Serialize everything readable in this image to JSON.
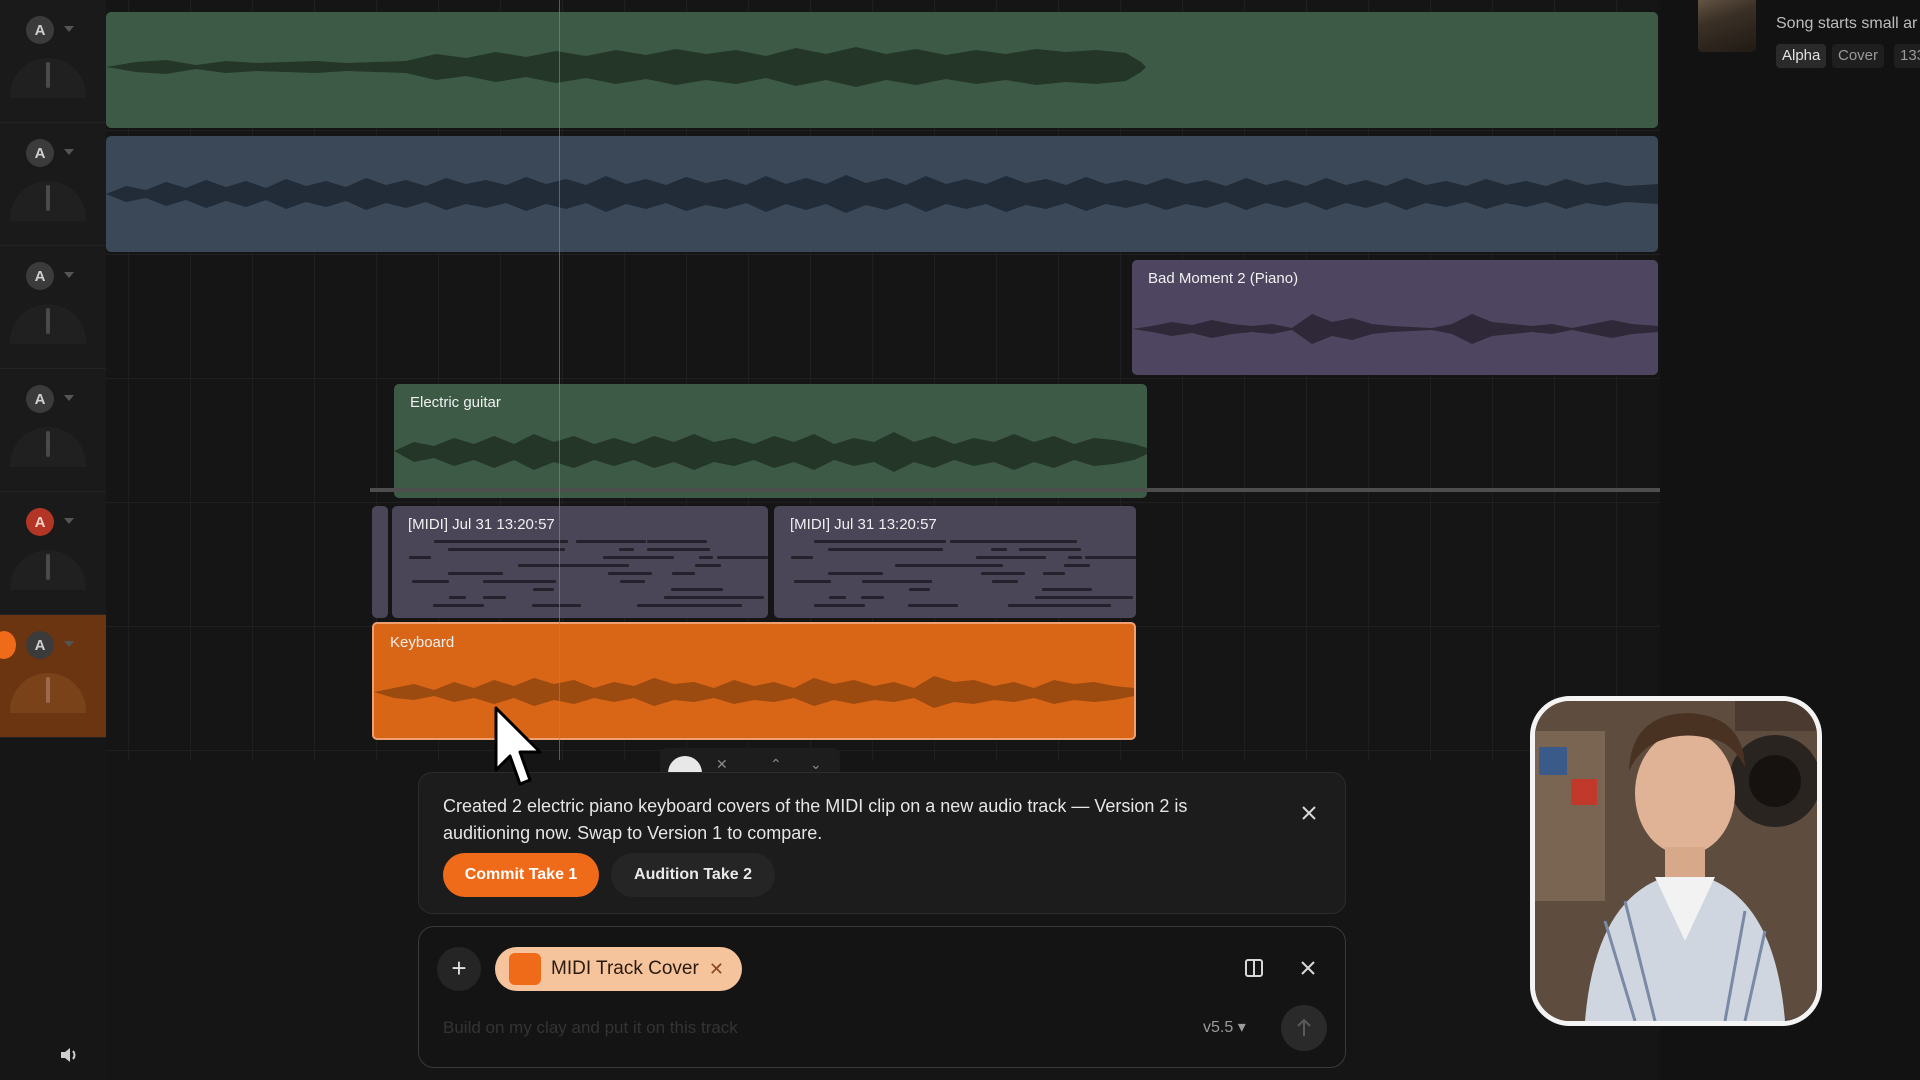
{
  "tracks": [
    {
      "arm": "A",
      "armed": false,
      "selected": false
    },
    {
      "arm": "A",
      "armed": false,
      "selected": false
    },
    {
      "arm": "A",
      "armed": false,
      "selected": false
    },
    {
      "arm": "A",
      "armed": false,
      "selected": false
    },
    {
      "arm": "A",
      "armed": true,
      "selected": false
    },
    {
      "arm": "A",
      "armed": false,
      "selected": true
    }
  ],
  "clips": {
    "track3": {
      "label": "Bad Moment 2 (Piano)"
    },
    "track4": {
      "label": "Electric guitar"
    },
    "midi1": {
      "label": "[MIDI] Jul 31 13:20:57"
    },
    "midi2": {
      "label": "[MIDI] Jul 31 13:20:57"
    },
    "keyboard": {
      "label": "Keyboard"
    }
  },
  "right_panel": {
    "song_title": "Song starts small ar",
    "tags": [
      "Alpha",
      "Cover",
      "133"
    ]
  },
  "toast": {
    "message": "Created 2 electric piano keyboard covers of the MIDI clip on a new audio track — Version 2 is auditioning now. Swap to Version 1 to compare.",
    "commit_label": "Commit Take 1",
    "audition_label": "Audition Take 2"
  },
  "prompt": {
    "chip_label": "MIDI Track Cover",
    "placeholder": "Build on my clay and put it on this track",
    "model_version": "v5.5"
  },
  "colors": {
    "accent": "#ef6a19",
    "track1_clip": "#3d5a46",
    "track2_clip": "#3a4858",
    "track3_clip": "#4e4660",
    "track4_clip": "#3d5a46",
    "midi_clip": "#4a4658",
    "keyboard_clip": "#d96517"
  }
}
